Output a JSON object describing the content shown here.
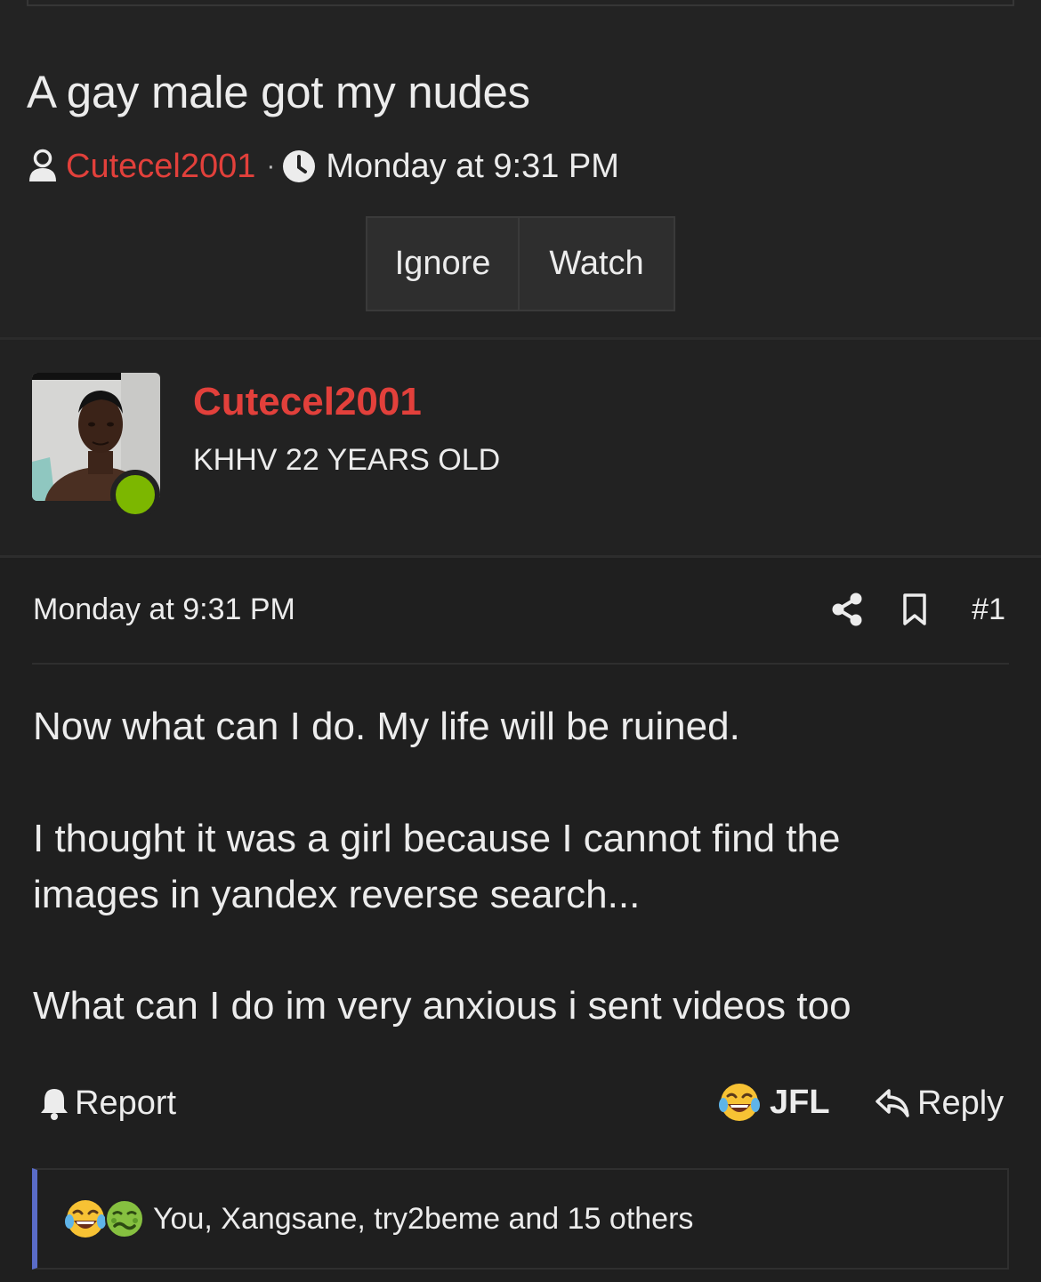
{
  "thread": {
    "title": "A gay male got my nudes",
    "author": "Cutecel2001",
    "separator": "·",
    "date": "Monday at 9:31 PM"
  },
  "thread_buttons": {
    "ignore": "Ignore",
    "watch": "Watch"
  },
  "user": {
    "username": "Cutecel2001",
    "title": "KHHV 22 YEARS OLD",
    "online_color": "#7cb700"
  },
  "post": {
    "date": "Monday at 9:31 PM",
    "number": "#1",
    "body": [
      "Now what can I do. My life will be ruined.",
      "I thought it was a girl because I cannot find the",
      "images in yandex reverse search...",
      "What can I do im very anxious i sent videos too"
    ]
  },
  "post_actions": {
    "report": "Report",
    "reaction": "JFL",
    "reply": "Reply"
  },
  "reactions": {
    "icons": [
      "laughing-crying-emoji",
      "nauseated-face-emoji"
    ],
    "summary": "You, Xangsane, try2beme and 15 others"
  },
  "colors": {
    "accent_red": "#e2403b",
    "reaction_bar_border": "#5a6cc8"
  }
}
